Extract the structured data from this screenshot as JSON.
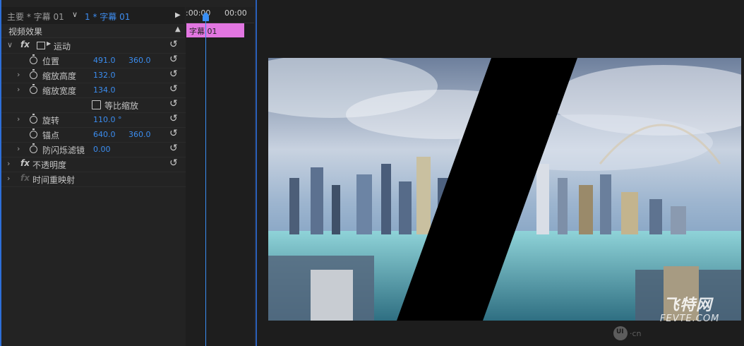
{
  "tabs": {
    "main": "主要 * 字幕 01",
    "dropdown": "∨",
    "active": "1 * 字幕 01",
    "play": "▶"
  },
  "section": {
    "title": "视频效果",
    "collapse": "▲"
  },
  "effects": {
    "motion": {
      "fx": "fx",
      "label": "运动",
      "expanded_caret": "∨",
      "properties": {
        "position": {
          "label": "位置",
          "x": "491.0",
          "y": "360.0"
        },
        "scale_height": {
          "label": "缩放高度",
          "value": "132.0"
        },
        "scale_width": {
          "label": "缩放宽度",
          "value": "134.0"
        },
        "uniform_scale": {
          "label": "等比缩放",
          "checked": false
        },
        "rotation": {
          "label": "旋转",
          "value": "110.0 °"
        },
        "anchor": {
          "label": "锚点",
          "x": "640.0",
          "y": "360.0"
        },
        "anti_flicker": {
          "label": "防闪烁滤镜",
          "value": "0.00"
        }
      }
    },
    "opacity": {
      "fx": "fx",
      "label": "不透明度"
    },
    "time_remap": {
      "fx": "fx",
      "label": "时间重映射"
    }
  },
  "caret_collapsed": "›",
  "reset_glyph": "↺",
  "timeline": {
    "ruler_start": ":00:00",
    "ruler_end": "00:00",
    "clip_label": "字幕 01",
    "clip_color": "#e276e1",
    "playhead_color": "#3a8ff4"
  },
  "watermark": {
    "logo": "UI",
    "suffix": "·cn",
    "brand_cn": "飞特网",
    "brand_en": "FEVTE.COM"
  },
  "colors": {
    "accent_blue": "#3b8df0",
    "panel_bg": "#232323"
  }
}
